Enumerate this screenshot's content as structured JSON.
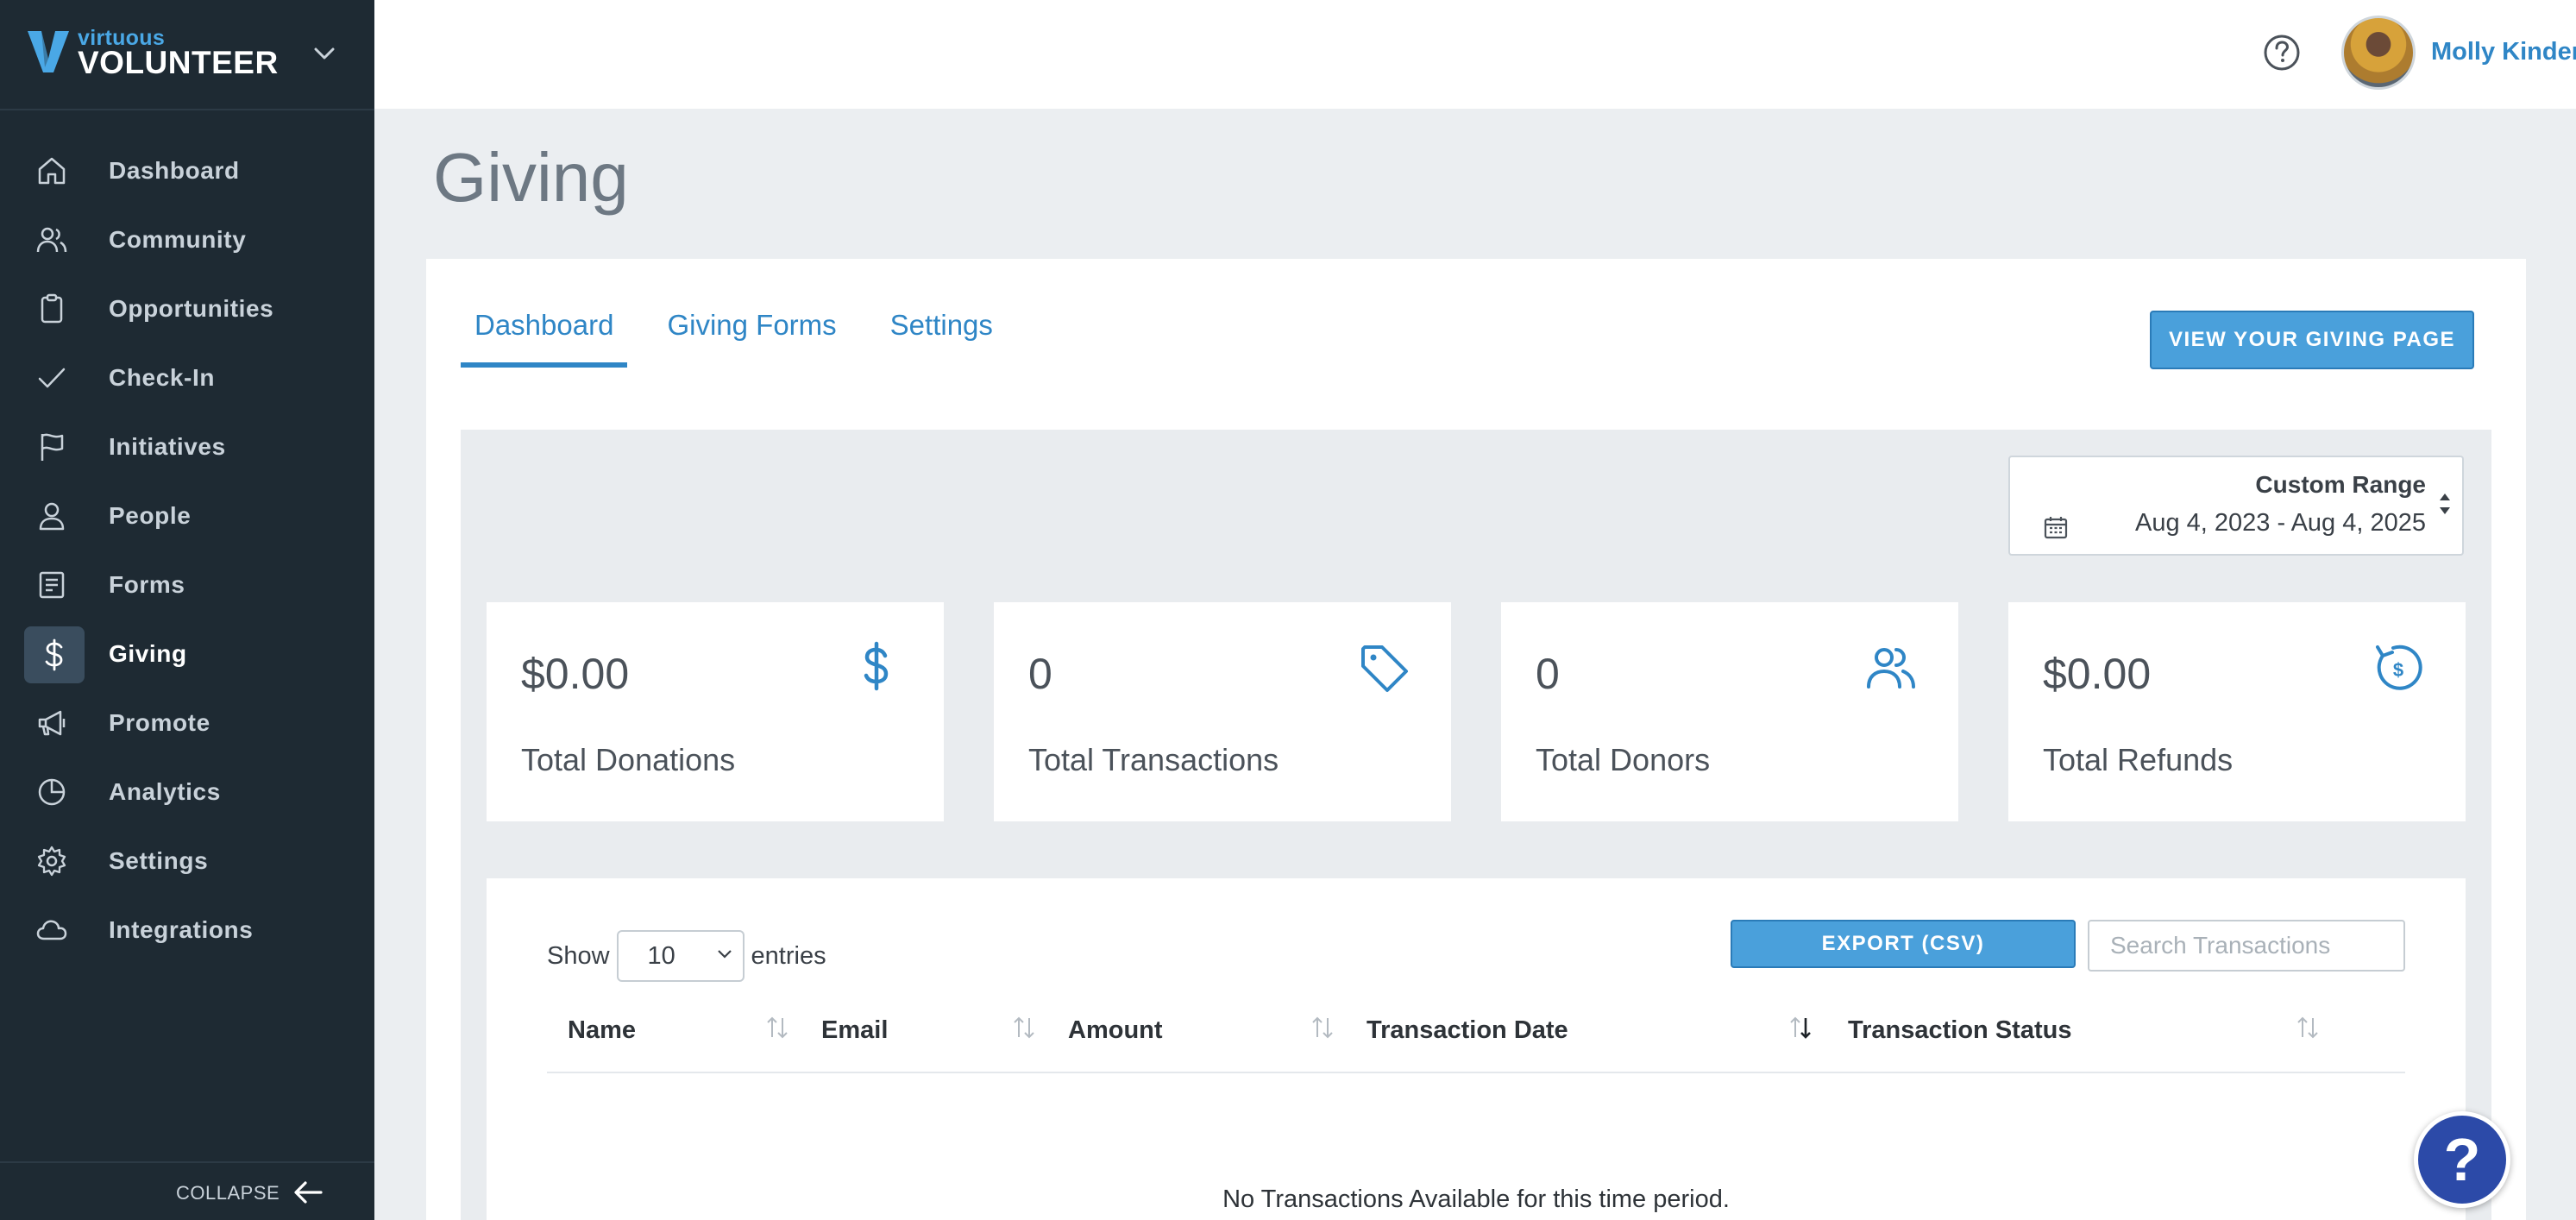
{
  "brand": {
    "sub": "virtuous",
    "main": "VOLUNTEER"
  },
  "sidebar": {
    "items": [
      {
        "label": "Dashboard",
        "icon": "home-icon"
      },
      {
        "label": "Community",
        "icon": "users-icon"
      },
      {
        "label": "Opportunities",
        "icon": "clipboard-icon"
      },
      {
        "label": "Check-In",
        "icon": "check-icon"
      },
      {
        "label": "Initiatives",
        "icon": "flag-icon"
      },
      {
        "label": "People",
        "icon": "person-icon"
      },
      {
        "label": "Forms",
        "icon": "form-icon"
      },
      {
        "label": "Giving",
        "icon": "dollar-icon",
        "active": true
      },
      {
        "label": "Promote",
        "icon": "megaphone-icon"
      },
      {
        "label": "Analytics",
        "icon": "pie-chart-icon"
      },
      {
        "label": "Settings",
        "icon": "gear-icon"
      },
      {
        "label": "Integrations",
        "icon": "cloud-icon"
      }
    ],
    "collapse_label": "COLLAPSE"
  },
  "header": {
    "user_name": "Molly Kinder"
  },
  "page": {
    "title": "Giving"
  },
  "tabs": [
    {
      "label": "Dashboard",
      "active": true
    },
    {
      "label": "Giving Forms"
    },
    {
      "label": "Settings"
    }
  ],
  "view_giving_button": "VIEW YOUR GIVING PAGE",
  "date_range": {
    "title": "Custom Range",
    "dates": "Aug 4, 2023 - Aug 4, 2025"
  },
  "stats": [
    {
      "value": "$0.00",
      "label": "Total Donations",
      "icon": "dollar-icon"
    },
    {
      "value": "0",
      "label": "Total Transactions",
      "icon": "tag-icon"
    },
    {
      "value": "0",
      "label": "Total Donors",
      "icon": "users-icon"
    },
    {
      "value": "$0.00",
      "label": "Total Refunds",
      "icon": "refund-icon"
    }
  ],
  "table": {
    "show_label": "Show",
    "entries_value": "10",
    "entries_label": "entries",
    "export_label": "EXPORT (CSV)",
    "search_placeholder": "Search Transactions",
    "columns": [
      "Name",
      "Email",
      "Amount",
      "Transaction Date",
      "Transaction Status"
    ],
    "empty_text": "No Transactions Available for this time period."
  },
  "help_fab": "?",
  "colors": {
    "accent": "#2f86c6",
    "sidebar_bg": "#1e2a33",
    "button": "#4aa0db",
    "fab": "#2c4aa8"
  }
}
